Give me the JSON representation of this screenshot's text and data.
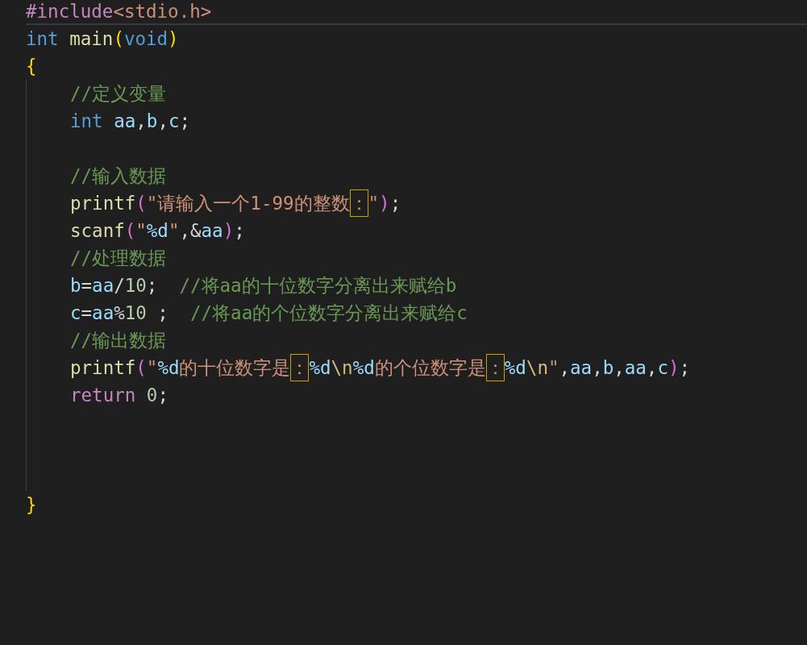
{
  "editor": {
    "lines": [
      {
        "kind": "code",
        "current": true,
        "tokens": [
          {
            "kind": "preproc",
            "text": "#include"
          },
          {
            "kind": "string",
            "text": "<stdio.h>"
          }
        ]
      },
      {
        "kind": "code",
        "current": false,
        "tokens": [
          {
            "kind": "keyword",
            "text": "int "
          },
          {
            "kind": "func",
            "text": "main"
          },
          {
            "kind": "paren1",
            "text": "("
          },
          {
            "kind": "keyword",
            "text": "void"
          },
          {
            "kind": "paren1",
            "text": ")"
          }
        ]
      },
      {
        "kind": "code",
        "current": false,
        "tokens": [
          {
            "kind": "paren1",
            "text": "{"
          }
        ]
      },
      {
        "kind": "block",
        "children": [
          {
            "kind": "code",
            "current": false,
            "tokens": [
              {
                "kind": "comment",
                "text": "//定义变量"
              }
            ]
          },
          {
            "kind": "code",
            "current": false,
            "tokens": [
              {
                "kind": "keyword",
                "text": "int "
              },
              {
                "kind": "var",
                "text": "aa"
              },
              {
                "kind": "plain",
                "text": ","
              },
              {
                "kind": "var",
                "text": "b"
              },
              {
                "kind": "plain",
                "text": ","
              },
              {
                "kind": "var",
                "text": "c"
              },
              {
                "kind": "plain",
                "text": ";"
              }
            ]
          },
          {
            "kind": "blank"
          },
          {
            "kind": "code",
            "current": false,
            "tokens": [
              {
                "kind": "comment",
                "text": "//输入数据"
              }
            ]
          },
          {
            "kind": "code",
            "current": false,
            "tokens": [
              {
                "kind": "func",
                "text": "printf"
              },
              {
                "kind": "paren2",
                "text": "("
              },
              {
                "kind": "string",
                "text": "\"请输入一个1-99的整数"
              },
              {
                "kind": "flagged",
                "text": "："
              },
              {
                "kind": "string",
                "text": "\""
              },
              {
                "kind": "paren2",
                "text": ")"
              },
              {
                "kind": "plain",
                "text": ";"
              }
            ]
          },
          {
            "kind": "code",
            "current": false,
            "tokens": [
              {
                "kind": "func",
                "text": "scanf"
              },
              {
                "kind": "paren2",
                "text": "("
              },
              {
                "kind": "string",
                "text": "\""
              },
              {
                "kind": "format",
                "text": "%d"
              },
              {
                "kind": "string",
                "text": "\""
              },
              {
                "kind": "plain",
                "text": ",&"
              },
              {
                "kind": "var",
                "text": "aa"
              },
              {
                "kind": "paren2",
                "text": ")"
              },
              {
                "kind": "plain",
                "text": ";"
              }
            ]
          },
          {
            "kind": "code",
            "current": false,
            "tokens": [
              {
                "kind": "comment",
                "text": "//处理数据"
              }
            ]
          },
          {
            "kind": "code",
            "current": false,
            "tokens": [
              {
                "kind": "var",
                "text": "b"
              },
              {
                "kind": "plain",
                "text": "="
              },
              {
                "kind": "var",
                "text": "aa"
              },
              {
                "kind": "plain",
                "text": "/"
              },
              {
                "kind": "number",
                "text": "10"
              },
              {
                "kind": "plain",
                "text": ";  "
              },
              {
                "kind": "comment",
                "text": "//将aa的十位数字分离出来赋给b"
              }
            ]
          },
          {
            "kind": "code",
            "current": false,
            "tokens": [
              {
                "kind": "var",
                "text": "c"
              },
              {
                "kind": "plain",
                "text": "="
              },
              {
                "kind": "var",
                "text": "aa"
              },
              {
                "kind": "plain",
                "text": "%"
              },
              {
                "kind": "number",
                "text": "10"
              },
              {
                "kind": "plain",
                "text": " ;  "
              },
              {
                "kind": "comment",
                "text": "//将aa的个位数字分离出来赋给c"
              }
            ]
          },
          {
            "kind": "code",
            "current": false,
            "tokens": [
              {
                "kind": "comment",
                "text": "//输出数据"
              }
            ]
          },
          {
            "kind": "code",
            "current": false,
            "tokens": [
              {
                "kind": "func",
                "text": "printf"
              },
              {
                "kind": "paren2",
                "text": "("
              },
              {
                "kind": "string",
                "text": "\""
              },
              {
                "kind": "format",
                "text": "%d"
              },
              {
                "kind": "string",
                "text": "的十位数字是"
              },
              {
                "kind": "flagged",
                "text": "："
              },
              {
                "kind": "format",
                "text": "%d"
              },
              {
                "kind": "escape",
                "text": "\\n"
              },
              {
                "kind": "format",
                "text": "%d"
              },
              {
                "kind": "string",
                "text": "的个位数字是"
              },
              {
                "kind": "flagged",
                "text": "："
              },
              {
                "kind": "format",
                "text": "%d"
              },
              {
                "kind": "escape",
                "text": "\\n"
              },
              {
                "kind": "string",
                "text": "\""
              },
              {
                "kind": "plain",
                "text": ","
              },
              {
                "kind": "var",
                "text": "aa"
              },
              {
                "kind": "plain",
                "text": ","
              },
              {
                "kind": "var",
                "text": "b"
              },
              {
                "kind": "plain",
                "text": ","
              },
              {
                "kind": "var",
                "text": "aa"
              },
              {
                "kind": "plain",
                "text": ","
              },
              {
                "kind": "var",
                "text": "c"
              },
              {
                "kind": "paren2",
                "text": ")"
              },
              {
                "kind": "plain",
                "text": ";"
              }
            ]
          },
          {
            "kind": "code",
            "current": false,
            "tokens": [
              {
                "kind": "control",
                "text": "return "
              },
              {
                "kind": "number",
                "text": "0"
              },
              {
                "kind": "plain",
                "text": ";"
              }
            ]
          },
          {
            "kind": "blank"
          },
          {
            "kind": "blank"
          },
          {
            "kind": "blank"
          }
        ]
      },
      {
        "kind": "code",
        "current": false,
        "tokens": [
          {
            "kind": "paren1",
            "text": "}"
          }
        ]
      }
    ]
  }
}
